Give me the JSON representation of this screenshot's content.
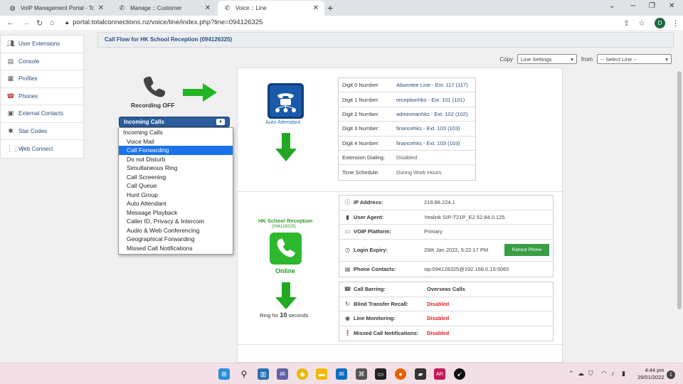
{
  "browser": {
    "tabs": [
      {
        "title": "VoIP Management Portal - Total C",
        "active": false
      },
      {
        "title": "Manage :: Customer",
        "active": false
      },
      {
        "title": "Voice :: Line",
        "active": true
      }
    ],
    "url": "portal.totalconnections.nz/voice/line/index.php?line=094126325",
    "profile_initial": "D"
  },
  "sidebar": {
    "items": [
      {
        "label": "User Extensions",
        "icon": "users-icon"
      },
      {
        "label": "Console",
        "icon": "console-icon"
      },
      {
        "label": "Profiles",
        "icon": "profiles-icon"
      },
      {
        "label": "Phones",
        "icon": "phone-icon"
      },
      {
        "label": "External Contacts",
        "icon": "contacts-icon"
      },
      {
        "label": "Star Codes",
        "icon": "star-icon"
      },
      {
        "label": "Web Connect",
        "icon": "grid-icon"
      }
    ]
  },
  "header": {
    "title": "Call Flow for HK School Reception (094126325)"
  },
  "copy_row": {
    "copy_label": "Copy",
    "copy_value": "Line Settings",
    "from_label": "from",
    "from_value": "-- Select Line --"
  },
  "recording": {
    "label": "Recording OFF"
  },
  "incoming": {
    "selected": "Incoming Calls",
    "options": [
      "Incoming Calls",
      "Voice Mail",
      "Call Forwarding",
      "Do not Disturb",
      "Simultaneous Ring",
      "Call Screening",
      "Call Queue",
      "Hunt Group",
      "Auto Attendant",
      "Message Playback",
      "Caller ID, Privacy & Intercom",
      "Audio & Web Conferencing",
      "Geographical Forwarding",
      "Missed Call Notifications"
    ],
    "highlighted": "Call Forwarding"
  },
  "auto_attendant": {
    "label": "Auto Attendant",
    "rows": [
      {
        "k": "Digit 0 Number:",
        "v": "Absentee Line - Ext. 117 (117)",
        "link": true
      },
      {
        "k": "Digit 1 Number:",
        "v": "receptionhks - Ext. 101 (101)",
        "link": true
      },
      {
        "k": "Digit 2 Number:",
        "v": "adminmanhks - Ext. 102 (102)",
        "link": true
      },
      {
        "k": "Digit 3 Number:",
        "v": "financehks - Ext. 103 (103)",
        "link": true
      },
      {
        "k": "Digit 4 Number:",
        "v": "financehks - Ext. 103 (103)",
        "link": true
      },
      {
        "k": "Extension Dialing:",
        "v": "Disabled",
        "link": false
      },
      {
        "k": "Time Schedule:",
        "v": "During Work Hours",
        "link": false
      }
    ]
  },
  "device": {
    "name": "HK School Reception",
    "number": "(094126325)",
    "status": "Online",
    "ring_prefix": "Ring for",
    "ring_seconds": "10",
    "ring_suffix": "seconds",
    "rows": [
      {
        "icon": "info-icon",
        "k": "IP Address:",
        "v": "219.88.224.1"
      },
      {
        "icon": "device-icon",
        "k": "User Agent:",
        "v": "Yealink SIP-T21P_E2 52.84.0.125"
      },
      {
        "icon": "monitor-icon",
        "k": "VOIP Platform:",
        "v": "Primary"
      },
      {
        "icon": "clock-icon",
        "k": "Login Expiry:",
        "v": "29th Jan 2022, 5:22:17 PM"
      },
      {
        "icon": "contact-card-icon",
        "k": "Phone Contacts:",
        "v": "sip:094126325@192.168.0.15:5060"
      }
    ],
    "reboot_label": "Reboot Phone"
  },
  "features": {
    "rows": [
      {
        "icon": "barring-icon",
        "k": "Call Barring:",
        "v": "Overseas Calls",
        "red": false
      },
      {
        "icon": "refresh-icon",
        "k": "Blind Transfer Recall:",
        "v": "Disabled",
        "red": true
      },
      {
        "icon": "eye-icon",
        "k": "Line Monitoring:",
        "v": "Disabled",
        "red": true
      },
      {
        "icon": "alert-icon",
        "k": "Missed Call Notifications:",
        "v": "Disabled",
        "red": true
      }
    ]
  },
  "taskbar": {
    "time": "4:44 pm",
    "date": "29/01/2022",
    "notifications": "1"
  },
  "colors": {
    "accent": "#2b5c9c",
    "green": "#2d9a2d",
    "red": "#e02020",
    "highlight": "#1a73e8"
  }
}
